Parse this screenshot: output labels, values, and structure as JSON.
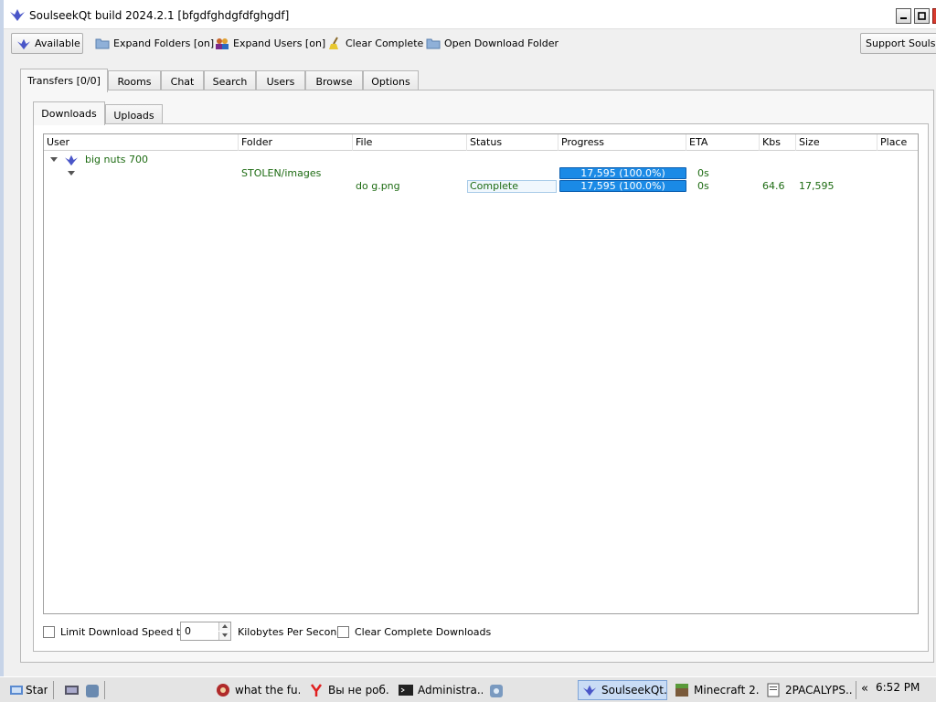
{
  "window": {
    "title": "SoulseekQt build 2024.2.1 [bfgdfghdgfdfghgdf]"
  },
  "toolbar": {
    "available": "Available",
    "expand_folders": "Expand Folders [on]",
    "expand_users": "Expand Users [on]",
    "clear_complete": "Clear Complete",
    "open_download_folder": "Open Download Folder",
    "support": "Support Soulseek"
  },
  "tabs": [
    "Transfers [0/0]",
    "Rooms",
    "Chat",
    "Search",
    "Users",
    "Browse",
    "Options"
  ],
  "subtabs": [
    "Downloads",
    "Uploads"
  ],
  "table": {
    "columns": [
      "User",
      "Folder",
      "File",
      "Status",
      "Progress",
      "ETA",
      "Kbs",
      "Size",
      "Place"
    ],
    "user": {
      "name": "big nuts 700"
    },
    "folder": {
      "name": "STOLEN/images",
      "progress": "17,595 (100.0%)",
      "eta": "0s"
    },
    "file": {
      "name": "do g.png",
      "status": "Complete",
      "progress": "17,595 (100.0%)",
      "eta": "0s",
      "kbs": "64.6",
      "size": "17,595"
    }
  },
  "bottom": {
    "limit_label": "Limit Download Speed to",
    "limit_value": "0",
    "unit_label": "Kilobytes Per Second",
    "clear_label": "Clear Complete Downloads"
  },
  "taskbar": {
    "start": "Start",
    "tasks": [
      "what the fu...",
      "Вы не роб...",
      "Administra...",
      "SoulseekQt...",
      "Minecraft 2...",
      "2PACALYPS..."
    ],
    "clock": "6:52 PM"
  }
}
